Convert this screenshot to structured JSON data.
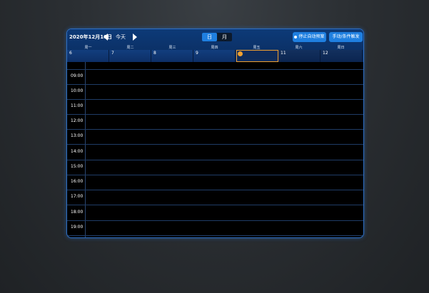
{
  "toolbar": {
    "date": "2020年12月10日",
    "today": "今天",
    "view_day": "日",
    "view_month": "月",
    "stop_label": "停止自动预案",
    "trigger_label": "手动/条件触发"
  },
  "weekdays": [
    "周一",
    "周二",
    "周三",
    "周四",
    "周五",
    "周六",
    "周日"
  ],
  "days": [
    "6",
    "7",
    "8",
    "9",
    "",
    "11",
    "12"
  ],
  "hours": [
    "09:00",
    "10:00",
    "11:00",
    "12:00",
    "13:00",
    "14:00",
    "15:00",
    "16:00",
    "17:00",
    "18:00",
    "19:00"
  ],
  "colors": {
    "accent": "#1f7fe0",
    "today_highlight": "#f0a030",
    "header_bg": "#0d3a78"
  }
}
